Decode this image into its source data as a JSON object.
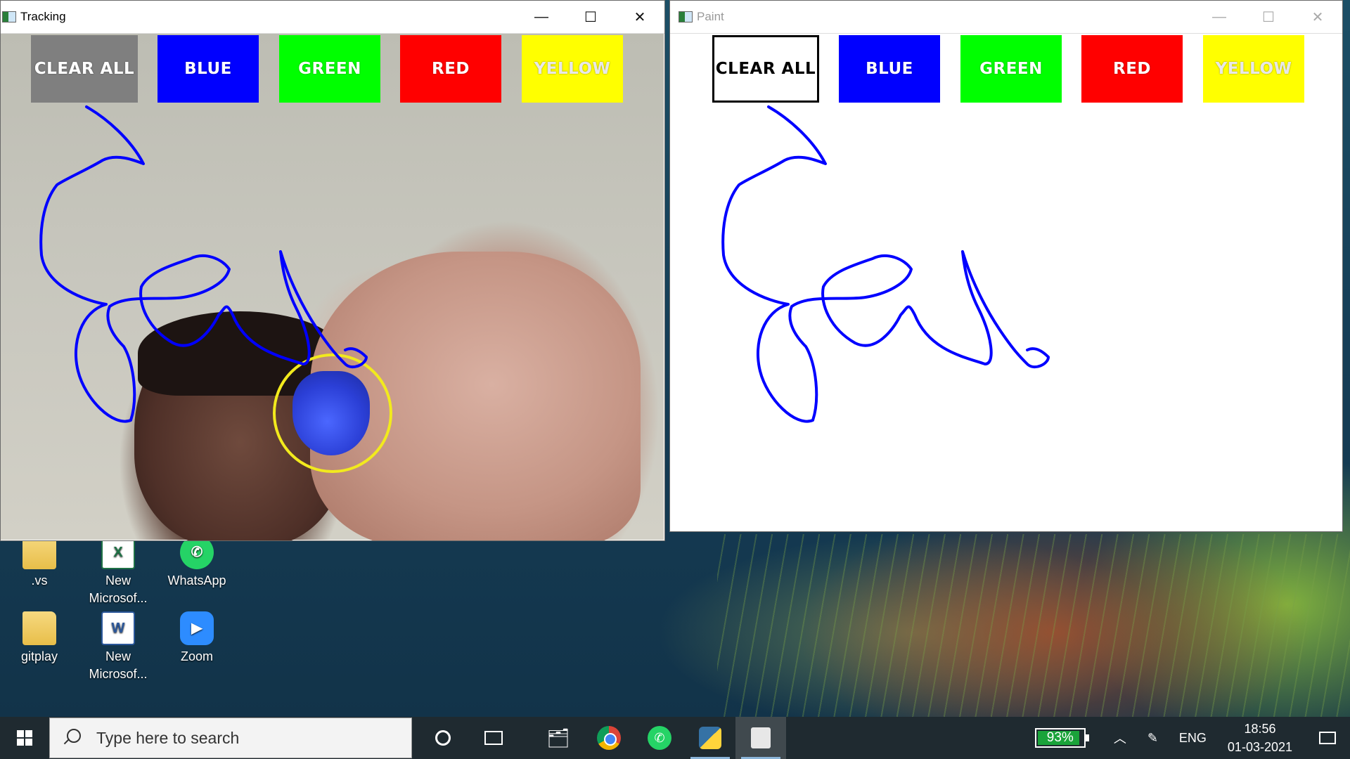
{
  "desktop": {
    "icons": [
      {
        "label": ".vs",
        "glyph": "folder"
      },
      {
        "label": "New Microsof...",
        "glyph": "excel"
      },
      {
        "label": "WhatsApp",
        "glyph": "whatsapp"
      },
      {
        "label": "gitplay",
        "glyph": "folder"
      },
      {
        "label": "New Microsof...",
        "glyph": "word"
      },
      {
        "label": "Zoom",
        "glyph": "zoom"
      }
    ]
  },
  "tracking_window": {
    "title": "Tracking",
    "buttons": [
      {
        "label": "CLEAR ALL",
        "color": "#7f7f7f"
      },
      {
        "label": "BLUE",
        "color": "#0000ff"
      },
      {
        "label": "GREEN",
        "color": "#00ff00"
      },
      {
        "label": "RED",
        "color": "#ff0000"
      },
      {
        "label": "YELLOW",
        "color": "#ffff00"
      }
    ]
  },
  "paint_window": {
    "title": "Paint",
    "buttons": [
      {
        "label": "CLEAR ALL",
        "color": "#ffffff"
      },
      {
        "label": "BLUE",
        "color": "#0000ff"
      },
      {
        "label": "GREEN",
        "color": "#00ff00"
      },
      {
        "label": "RED",
        "color": "#ff0000"
      },
      {
        "label": "YELLOW",
        "color": "#ffff00"
      }
    ],
    "stroke_color": "#0000ff"
  },
  "taskbar": {
    "search_placeholder": "Type here to search",
    "pinned": [
      "cortana-icon",
      "task-view-icon",
      "file-explorer-icon",
      "chrome-icon",
      "whatsapp-icon",
      "python-icon",
      "idle-icon"
    ],
    "battery": "93%",
    "battery_level": 0.93,
    "language": "ENG",
    "time": "18:56",
    "date": "01-03-2021"
  },
  "colors": {
    "marker_circle": "#f2ea1d",
    "drawing_stroke": "#0000ff"
  }
}
